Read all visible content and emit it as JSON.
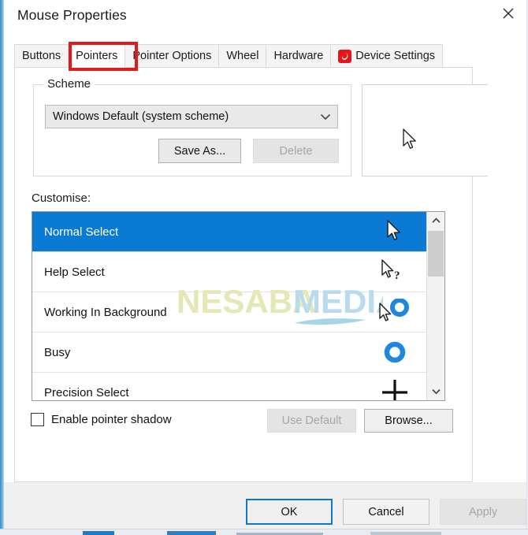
{
  "window": {
    "title": "Mouse Properties",
    "close_icon": "close-icon"
  },
  "tabs": [
    {
      "id": "buttons",
      "label": "Buttons",
      "active": false,
      "icon": null
    },
    {
      "id": "pointers",
      "label": "Pointers",
      "active": true,
      "icon": null
    },
    {
      "id": "pointer-options",
      "label": "Pointer Options",
      "active": false,
      "icon": null
    },
    {
      "id": "wheel",
      "label": "Wheel",
      "active": false,
      "icon": null
    },
    {
      "id": "hardware",
      "label": "Hardware",
      "active": false,
      "icon": null
    },
    {
      "id": "device-settings",
      "label": "Device Settings",
      "active": false,
      "icon": "device-settings-icon"
    }
  ],
  "annotation": {
    "highlight_color": "#e01b1b",
    "target_tab": "Pointers"
  },
  "scheme": {
    "group_title": "Scheme",
    "selected": "Windows Default (system scheme)",
    "dropdown_icon": "chevron-down-icon",
    "save_as_label": "Save As...",
    "delete_label": "Delete",
    "delete_disabled": true
  },
  "preview": {
    "cursor": "normal-select-cursor"
  },
  "customise": {
    "label": "Customise:",
    "items": [
      {
        "label": "Normal Select",
        "glyph": "arrow-cursor",
        "selected": true
      },
      {
        "label": "Help Select",
        "glyph": "arrow-question-cursor",
        "selected": false
      },
      {
        "label": "Working In Background",
        "glyph": "arrow-ring-cursor",
        "selected": false
      },
      {
        "label": "Busy",
        "glyph": "ring-cursor",
        "selected": false
      },
      {
        "label": "Precision Select",
        "glyph": "crosshair-cursor",
        "selected": false
      }
    ],
    "selection_color": "#0b7ad4",
    "scrollbar": {
      "up_icon": "chevron-up-icon",
      "down_icon": "chevron-down-icon"
    }
  },
  "options": {
    "enable_pointer_shadow_label": "Enable pointer shadow",
    "enable_pointer_shadow_checked": false,
    "use_default_label": "Use Default",
    "use_default_disabled": true,
    "browse_label": "Browse..."
  },
  "dialog_buttons": {
    "ok_label": "OK",
    "cancel_label": "Cancel",
    "apply_label": "Apply",
    "apply_disabled": true,
    "focus_color": "#0a7ad1"
  },
  "watermark": {
    "text_primary": "NESABA",
    "text_secondary": "MEDIA",
    "color_primary": "#e3e8b4",
    "color_secondary": "#b8dced"
  }
}
